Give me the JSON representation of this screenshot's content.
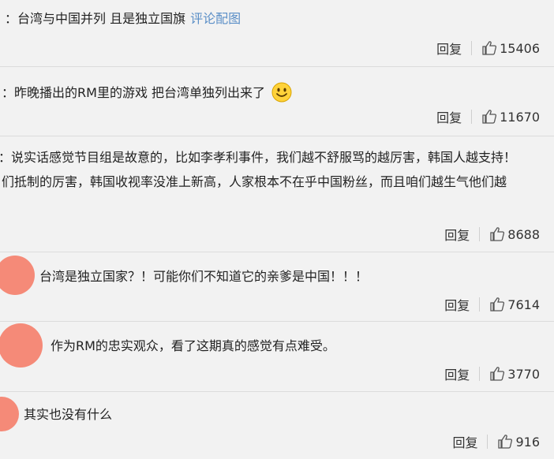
{
  "comments": [
    {
      "prefix": "：",
      "text": "台湾与中国并列 且是独立国旗",
      "link": "评论配图",
      "reply": "回复",
      "likes": "15406"
    },
    {
      "prefix": "：",
      "text": "昨晚播出的RM里的游戏 把台湾单独列出来了",
      "emoji": "smile-emoji",
      "reply": "回复",
      "likes": "11670"
    },
    {
      "line1": "：说实话感觉节目组是故意的，比如李孝利事件，我们越不舒服骂的越厉害，韩国人越支持！",
      "line2": "们抵制的厉害，韩国收视率没准上新高，人家根本不在乎中国粉丝，而且咱们越生气他们越",
      "reply": "回复",
      "likes": "8688"
    },
    {
      "text": "台湾是独立国家？！可能你们不知道它的亲爹是中国！！！",
      "reply": "回复",
      "likes": "7614"
    },
    {
      "text": "作为RM的忠实观众，看了这期真的感觉有点难受。",
      "reply": "回复",
      "likes": "3770"
    },
    {
      "text": "其实也没有什么",
      "reply": "回复",
      "likes": "916"
    }
  ],
  "icons": {
    "like": "thumbs-up-icon",
    "avatar_color": "#f58a78",
    "link_color": "#5b8fc7"
  }
}
